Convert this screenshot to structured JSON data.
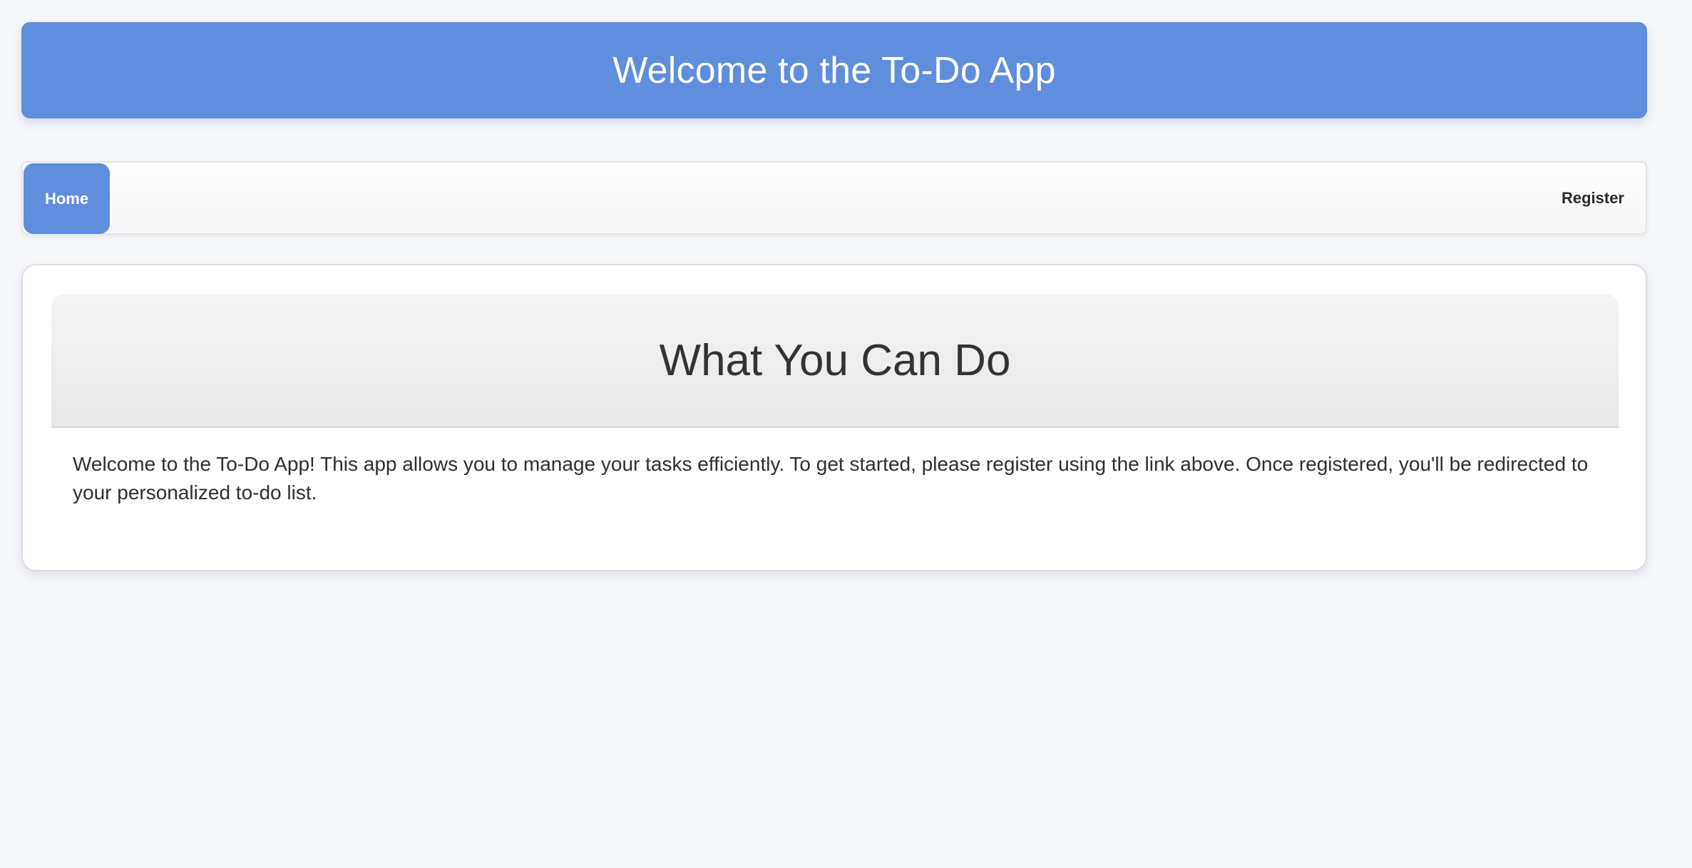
{
  "header": {
    "title": "Welcome to the To-Do App"
  },
  "nav": {
    "home_label": "Home",
    "register_label": "Register"
  },
  "main": {
    "card_title": "What You Can Do",
    "card_text": "Welcome to the To-Do App! This app allows you to manage your tasks efficiently. To get started, please register using the link above. Once registered, you'll be redirected to your personalized to-do list."
  },
  "colors": {
    "accent": "#5e8edc",
    "background": "#f5f7fb"
  }
}
